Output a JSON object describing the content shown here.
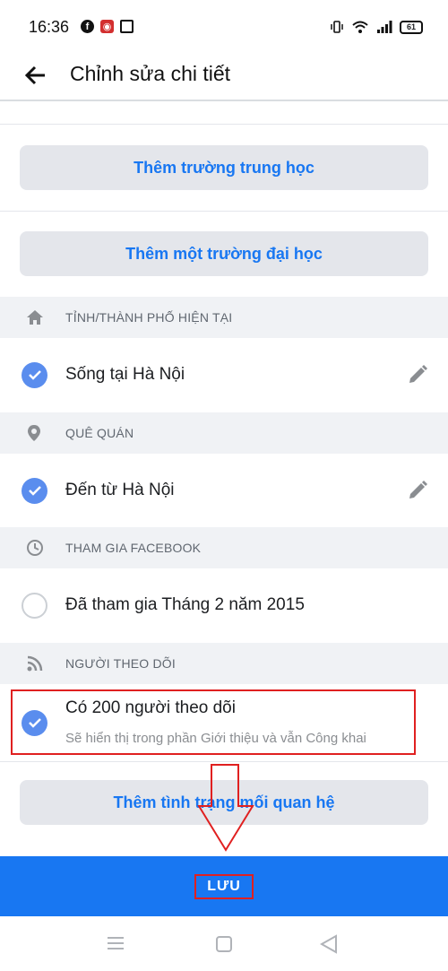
{
  "status": {
    "time": "16:36",
    "battery": "61"
  },
  "header": {
    "title": "Chỉnh sửa chi tiết"
  },
  "education": {
    "add_high_school": "Thêm trường trung học",
    "add_university": "Thêm một trường đại học"
  },
  "sections": {
    "current_city": {
      "heading": "TỈNH/THÀNH PHỐ HIỆN TẠI",
      "value": "Sống tại Hà Nội",
      "checked": true
    },
    "hometown": {
      "heading": "QUÊ QUÁN",
      "value": "Đến từ Hà Nội",
      "checked": true
    },
    "joined": {
      "heading": "THAM GIA FACEBOOK",
      "value": "Đã tham gia Tháng 2 năm 2015",
      "checked": false
    },
    "followers": {
      "heading": "NGƯỜI THEO DÕI",
      "value": "Có 200 người theo dõi",
      "sub": "Sẽ hiển thị trong phần Giới thiệu và vẫn Công khai",
      "checked": true
    }
  },
  "relationship": {
    "add_label": "Thêm tình trạng mối quan hệ"
  },
  "save": {
    "label": "LƯU"
  },
  "colors": {
    "accent": "#1877f2",
    "check": "#5a8dee",
    "annotation": "#e02020"
  },
  "icons": [
    "back-arrow-icon",
    "home-icon",
    "location-pin-icon",
    "clock-icon",
    "rss-icon",
    "pencil-icon",
    "check-icon"
  ]
}
